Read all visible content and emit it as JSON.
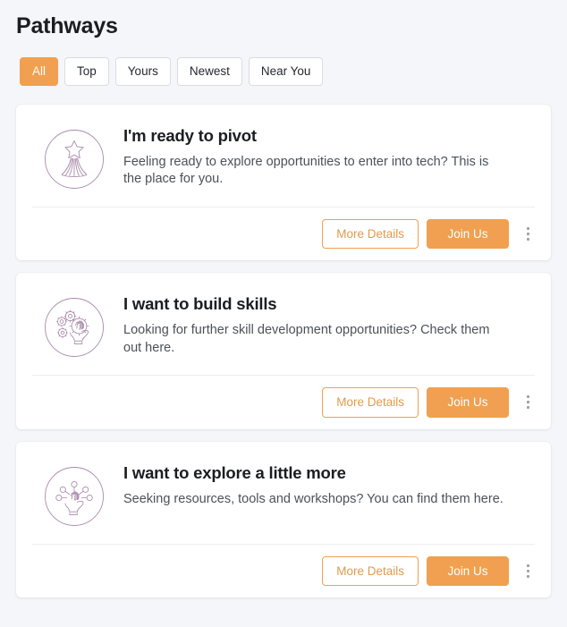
{
  "header": {
    "title": "Pathways"
  },
  "filters": {
    "items": [
      {
        "label": "All",
        "active": true
      },
      {
        "label": "Top",
        "active": false
      },
      {
        "label": "Yours",
        "active": false
      },
      {
        "label": "Newest",
        "active": false
      },
      {
        "label": "Near You",
        "active": false
      }
    ]
  },
  "colors": {
    "accent": "#f0a050",
    "page_background": "#f4f6f9",
    "card_background": "#ffffff",
    "icon_stroke": "#a98bab",
    "title_text": "#1b1d21",
    "body_text": "#4c5158"
  },
  "actions": {
    "more_details_label": "More Details",
    "join_us_label": "Join Us",
    "menu_icon": "kebab-menu-icon"
  },
  "cards": [
    {
      "icon": "shooting-star-icon",
      "title": "I'm ready to pivot",
      "description": "Feeling ready to explore opportunities to enter into tech? This is the place for you."
    },
    {
      "icon": "gears-fingerprint-touch-icon",
      "title": "I want to build skills",
      "description": "Looking for further skill development opportunities? Check them out here."
    },
    {
      "icon": "network-fingerprint-touch-icon",
      "title": "I want to explore a little more",
      "description": "Seeking resources, tools and workshops? You can find them here."
    }
  ]
}
